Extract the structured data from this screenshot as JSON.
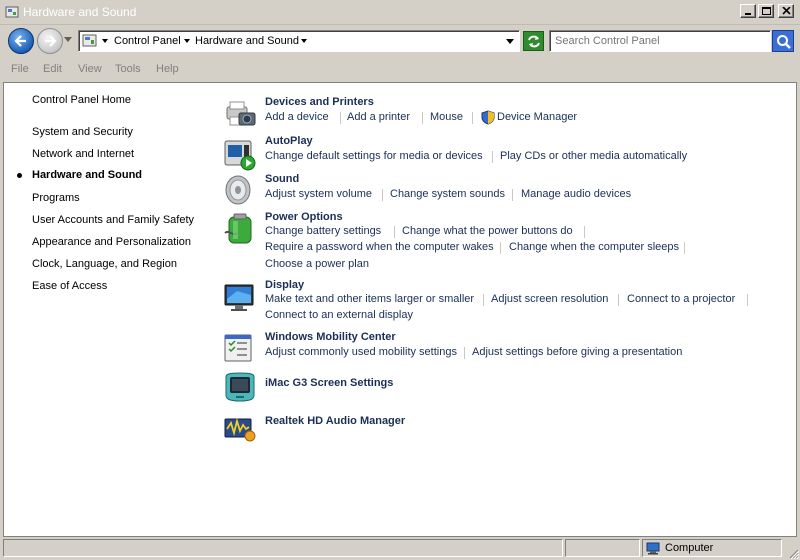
{
  "window": {
    "title": "Hardware and Sound"
  },
  "address": {
    "crumbs": [
      "Control Panel",
      "Hardware and Sound"
    ]
  },
  "search": {
    "placeholder": "Search Control Panel"
  },
  "menu": [
    "File",
    "Edit",
    "View",
    "Tools",
    "Help"
  ],
  "sidebar": {
    "home": "Control Panel Home",
    "items": [
      "System and Security",
      "Network and Internet",
      "Hardware and Sound",
      "Programs",
      "User Accounts and Family Safety",
      "Appearance and Personalization",
      "Clock, Language, and Region",
      "Ease of Access"
    ],
    "current_index": 2
  },
  "categories": [
    {
      "title": "Devices and Printers",
      "icon": "printer-camera-icon",
      "tasks": [
        "Add a device",
        "Add a printer",
        "Mouse",
        "Device Manager"
      ]
    },
    {
      "title": "AutoPlay",
      "icon": "autoplay-icon",
      "tasks": [
        "Change default settings for media or devices",
        "Play CDs or other media automatically"
      ]
    },
    {
      "title": "Sound",
      "icon": "speaker-icon",
      "tasks": [
        "Adjust system volume",
        "Change system sounds",
        "Manage audio devices"
      ]
    },
    {
      "title": "Power Options",
      "icon": "battery-icon",
      "tasks": [
        "Change battery settings",
        "Change what the power buttons do",
        "Require a password when the computer wakes",
        "Change when the computer sleeps",
        "Choose a power plan"
      ]
    },
    {
      "title": "Display",
      "icon": "monitor-icon",
      "tasks": [
        "Make text and other items larger or smaller",
        "Adjust screen resolution",
        "Connect to a projector",
        "Connect to an external display"
      ]
    },
    {
      "title": "Windows Mobility Center",
      "icon": "mobility-center-icon",
      "tasks": [
        "Adjust commonly used mobility settings",
        "Adjust settings before giving a presentation"
      ]
    },
    {
      "title": "iMac G3 Screen Settings",
      "icon": "imac-icon",
      "tasks": []
    },
    {
      "title": "Realtek HD Audio Manager",
      "icon": "realtek-audio-icon",
      "tasks": []
    }
  ],
  "status": {
    "location": "Computer"
  },
  "colors": {
    "link": "#1b2f55",
    "titlebar_text": "#ffffff"
  }
}
